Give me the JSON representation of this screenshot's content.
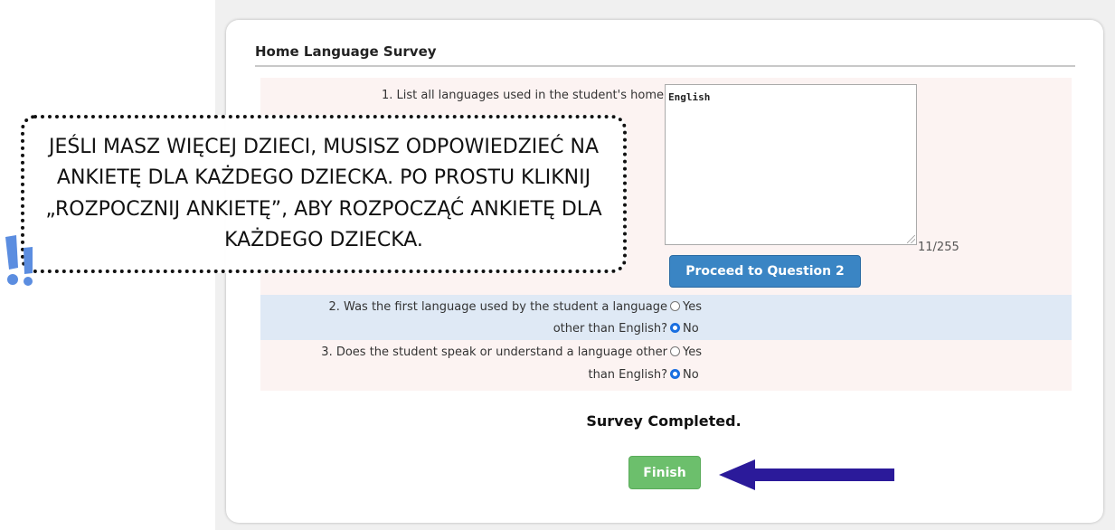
{
  "survey": {
    "title": "Home Language Survey",
    "q1": {
      "text": "1. List all languages used in the student's home",
      "answer": "English",
      "counter": "11/255",
      "proceed_label": "Proceed to Question 2"
    },
    "q2": {
      "text_line1": "2. Was the first language used by the student a language",
      "text_line2": "other than English?",
      "options": [
        "Yes",
        "No"
      ],
      "selected": "No"
    },
    "q3": {
      "text_line1": "3. Does the student speak or understand a language other",
      "text_line2": "than English?",
      "options": [
        "Yes",
        "No"
      ],
      "selected": "No"
    },
    "status": "Survey Completed.",
    "finish_label": "Finish"
  },
  "callout": {
    "text": "JEŚLI MASZ WIĘCEJ DZIECI, MUSISZ ODPOWIEDZIEĆ NA ANKIETĘ DLA KAŻDEGO DZIECKA. PO PROSTU KLIKNIJ „ROZPOCZNIJ ANKIETĘ”, ABY ROZPOCZĄĆ ANKIETĘ DLA KAŻDEGO DZIECKA."
  },
  "colors": {
    "proceed": "#3a85c4",
    "finish": "#6cbf6c",
    "arrow": "#2b1a9a",
    "exclamation": "#5b8de0"
  },
  "icons": [
    "double-exclamation-icon",
    "arrow-left-icon",
    "resize-handle-icon"
  ]
}
